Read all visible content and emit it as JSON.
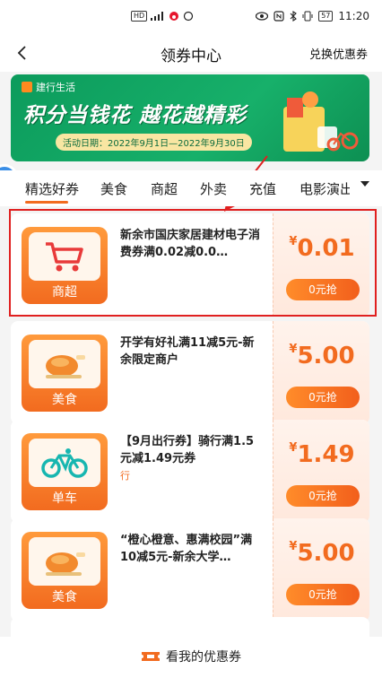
{
  "status_bar": {
    "time": "11:20",
    "battery": "57",
    "signal_text": "HD"
  },
  "nav": {
    "title": "领券中心",
    "back_icon": "back-arrow-icon",
    "right_link": "兑换优惠券"
  },
  "banner": {
    "brand": "建行生活",
    "slogan": "积分当钱花 越花越精彩",
    "date_text": "活动日期：2022年9月1日—2022年9月30日"
  },
  "categories": {
    "items": [
      "精选好券",
      "美食",
      "商超",
      "外卖",
      "充值",
      "电影演出"
    ],
    "active_index": 0,
    "more_icon": "chevron-down-icon"
  },
  "coupons": [
    {
      "icon": "shopping-cart-icon",
      "category": "商超",
      "desc": "新余市国庆家居建材电子消费券满0.02减0.0…",
      "tag": "",
      "currency": "¥",
      "amount": "0.01",
      "button": "0元抢"
    },
    {
      "icon": "roast-chicken-icon",
      "category": "美食",
      "desc": "开学有好礼满11减5元-新余限定商户",
      "tag": "",
      "currency": "¥",
      "amount": "5.00",
      "button": "0元抢"
    },
    {
      "icon": "bicycle-icon",
      "category": "单车",
      "desc": "【9月出行券】骑行满1.5元减1.49元券",
      "tag": "行",
      "currency": "¥",
      "amount": "1.49",
      "button": "0元抢"
    },
    {
      "icon": "roast-chicken-icon",
      "category": "美食",
      "desc": "“橙心橙意、惠满校园”满10减5元-新余大学…",
      "tag": "",
      "currency": "¥",
      "amount": "5.00",
      "button": "0元抢"
    }
  ],
  "bottom_bar": {
    "icon": "coupon-ticket-icon",
    "label": "看我的优惠券"
  },
  "colors": {
    "accent": "#f26b1f",
    "highlight": "#e02020",
    "banner_green": "#17b06a"
  }
}
